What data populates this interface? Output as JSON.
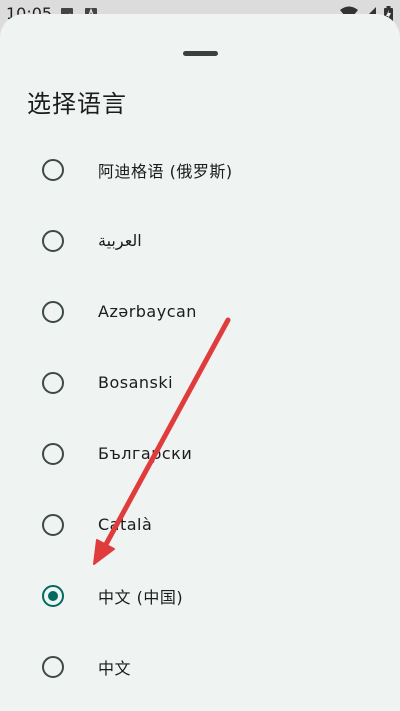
{
  "status_bar": {
    "time": "10:05",
    "icons": [
      "image-icon",
      "a-letter-icon",
      "wifi-icon",
      "signal-icon",
      "battery-icon"
    ]
  },
  "sheet": {
    "title": "选择语言"
  },
  "languages": [
    {
      "label": "阿迪格语 (俄罗斯)",
      "selected": false
    },
    {
      "label": "العربية",
      "selected": false
    },
    {
      "label": "Azərbaycan",
      "selected": false
    },
    {
      "label": "Bosanski",
      "selected": false
    },
    {
      "label": "Български",
      "selected": false
    },
    {
      "label": "Català",
      "selected": false
    },
    {
      "label": "中文 (中国)",
      "selected": true
    },
    {
      "label": "中文",
      "selected": false
    }
  ],
  "colors": {
    "accent": "#006a60",
    "annotation_arrow": "#e03c3c"
  }
}
